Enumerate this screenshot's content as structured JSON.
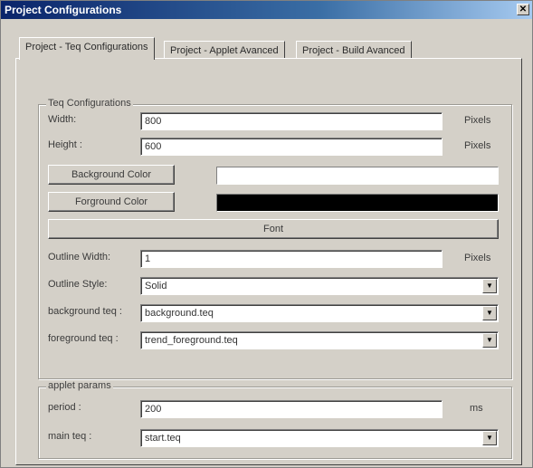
{
  "window": {
    "title": "Project Configurations",
    "close_glyph": "✕"
  },
  "tabs": [
    {
      "label": "Project - Teq Configurations"
    },
    {
      "label": "Project - Applet Avanced"
    },
    {
      "label": "Project - Build Avanced"
    }
  ],
  "teq_group": {
    "legend": "Teq Configurations",
    "width": {
      "label": "Width:",
      "value": "800",
      "unit": "Pixels"
    },
    "height": {
      "label": "Height :",
      "value": "600",
      "unit": "Pixels"
    },
    "background_color": {
      "button": "Background Color",
      "color": "#ffffff"
    },
    "foreground_color": {
      "button": "Forground Color",
      "color": "#000000"
    },
    "font_button": "Font",
    "outline_width": {
      "label": "Outline Width:",
      "value": "1",
      "unit": "Pixels"
    },
    "outline_style": {
      "label": "Outline Style:",
      "value": "Solid"
    },
    "background_teq": {
      "label": "background teq :",
      "value": "background.teq"
    },
    "foreground_teq": {
      "label": "foreground teq :",
      "value": "trend_foreground.teq"
    }
  },
  "applet_group": {
    "legend": "applet params",
    "period": {
      "label": "period :",
      "value": "200",
      "unit": "ms"
    },
    "main_teq": {
      "label": "main teq :",
      "value": "start.teq"
    }
  },
  "icons": {
    "dropdown_arrow": "▼"
  }
}
